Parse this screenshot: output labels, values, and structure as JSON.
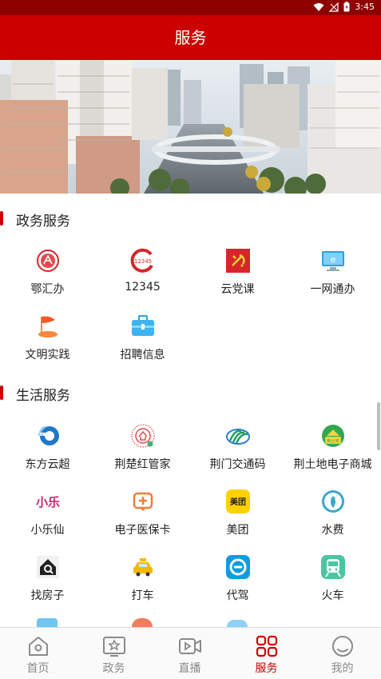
{
  "status_bar": {
    "time": "3:45"
  },
  "header": {
    "title": "服务"
  },
  "sections": [
    {
      "title": "政务服务",
      "items": [
        {
          "label": "鄂汇办",
          "icon": "ehuiban-icon"
        },
        {
          "label": "12345",
          "icon": "hotline-12345-icon"
        },
        {
          "label": "云党课",
          "icon": "party-flag-icon"
        },
        {
          "label": "一网通办",
          "icon": "monitor-e-icon"
        },
        {
          "label": "文明实践",
          "icon": "flag-icon"
        },
        {
          "label": "招聘信息",
          "icon": "briefcase-icon"
        }
      ]
    },
    {
      "title": "生活服务",
      "items": [
        {
          "label": "东方云超",
          "icon": "dongfang-yunchao-icon"
        },
        {
          "label": "荆楚红管家",
          "icon": "jingchu-housekeeper-icon"
        },
        {
          "label": "荆门交通码",
          "icon": "traffic-code-icon"
        },
        {
          "label": "荆土地电子商城",
          "icon": "land-mall-icon"
        },
        {
          "label": "小乐仙",
          "icon": "xiaolexian-icon"
        },
        {
          "label": "电子医保卡",
          "icon": "medical-card-icon"
        },
        {
          "label": "美团",
          "icon": "meituan-icon"
        },
        {
          "label": "水费",
          "icon": "water-fee-icon"
        },
        {
          "label": "找房子",
          "icon": "house-search-icon"
        },
        {
          "label": "打车",
          "icon": "taxi-icon"
        },
        {
          "label": "代驾",
          "icon": "designated-driver-icon"
        },
        {
          "label": "火车",
          "icon": "train-icon"
        }
      ]
    }
  ],
  "tabs": [
    {
      "label": "首页",
      "icon": "home-icon",
      "active": false
    },
    {
      "label": "政务",
      "icon": "government-icon",
      "active": false
    },
    {
      "label": "直播",
      "icon": "live-video-icon",
      "active": false
    },
    {
      "label": "服务",
      "icon": "grid-services-icon",
      "active": true
    },
    {
      "label": "我的",
      "icon": "profile-icon",
      "active": false
    }
  ],
  "colors": {
    "brand_red": "#cc0000",
    "status_bar": "#8e0000",
    "inactive_tab": "#8a8a8a"
  }
}
